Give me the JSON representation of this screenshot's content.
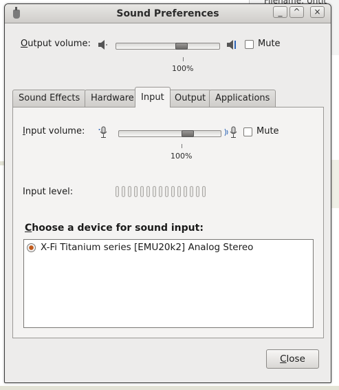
{
  "background": {
    "other_window_text": "Filename:  Untit"
  },
  "window": {
    "title": "Sound Preferences",
    "controls": [
      "_",
      "^",
      "×"
    ]
  },
  "output": {
    "label_prefix": "O",
    "label_rest": "utput volume:",
    "percent": "100%",
    "volume_fraction": 0.65,
    "mute_label": "Mute",
    "mute_checked": false
  },
  "tabs": [
    {
      "label": "Sound Effects"
    },
    {
      "label": "Hardware"
    },
    {
      "label": "Input",
      "active": true
    },
    {
      "label": "Output"
    },
    {
      "label": "Applications"
    }
  ],
  "input": {
    "label_prefix": "I",
    "label_rest": "nput volume:",
    "percent": "100%",
    "volume_fraction": 0.7,
    "mute_label": "Mute",
    "mute_checked": false,
    "level_label": "Input level:",
    "level_segments": 15,
    "level_value": 0,
    "device_heading_prefix": "C",
    "device_heading_rest": "hoose a device for sound input:",
    "devices": [
      {
        "label": "X-Fi Titanium series [EMU20k2] Analog Stereo",
        "selected": true
      }
    ]
  },
  "buttons": {
    "close_prefix": "C",
    "close_rest": "lose"
  },
  "colors": {
    "radio_selected": "#c25a1c",
    "window_bg": "#edeceb"
  }
}
